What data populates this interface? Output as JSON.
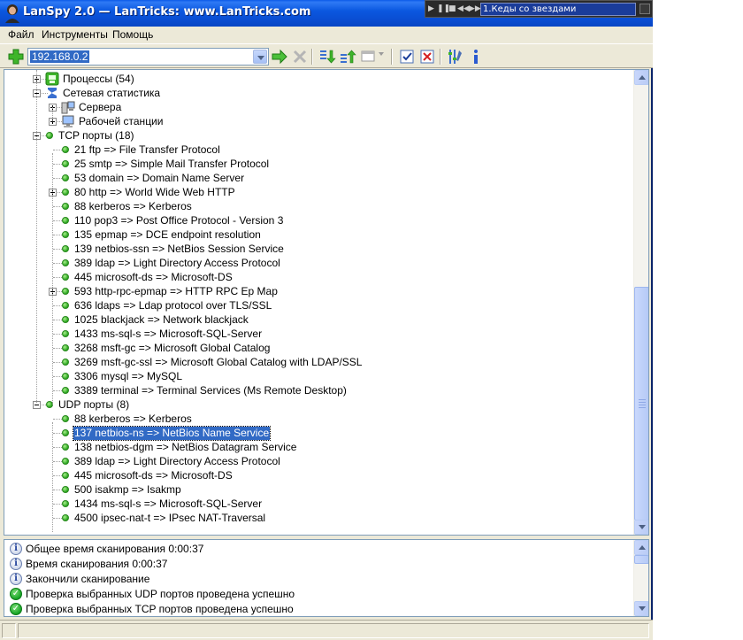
{
  "window": {
    "title": "LanSpy 2.0 — LanTricks: www.LanTricks.com"
  },
  "player": {
    "controls": [
      "play-icon",
      "pause-icon",
      "stop-icon",
      "prev-icon",
      "next-icon"
    ],
    "track": "1.Кеды со звездами"
  },
  "menu": {
    "items": [
      "Файл",
      "Инструменты",
      "Помощь"
    ]
  },
  "toolbar": {
    "address_value": "192.168.0.2",
    "buttons": [
      "add-icon",
      "go-arrow-icon",
      "stop-x-icon",
      "import-icon",
      "export-icon",
      "view-icon",
      "check-icon",
      "uncheck-icon",
      "settings-icon",
      "info-icon"
    ]
  },
  "tree": {
    "processes": "Процессы (54)",
    "netstat": "Сетевая статистика",
    "servers": "Сервера",
    "workstations": "Рабочей станции",
    "tcp_header": "TCP порты (18)",
    "tcp": [
      "21 ftp => File Transfer Protocol",
      "25 smtp => Simple Mail Transfer Protocol",
      "53 domain => Domain Name Server",
      "80 http => World Wide Web HTTP",
      "88 kerberos => Kerberos",
      "110 pop3 => Post Office Protocol - Version 3",
      "135 epmap => DCE endpoint resolution",
      "139 netbios-ssn => NetBios Session Service",
      "389 ldap => Light Directory Access Protocol",
      "445 microsoft-ds => Microsoft-DS",
      "593 http-rpc-epmap => HTTP RPC Ep Map",
      "636 ldaps => Ldap protocol over TLS/SSL",
      "1025 blackjack => Network blackjack",
      "1433 ms-sql-s => Microsoft-SQL-Server",
      "3268 msft-gc => Microsoft Global Catalog",
      "3269 msft-gc-ssl => Microsoft Global Catalog with LDAP/SSL",
      "3306 mysql => MySQL",
      "3389 terminal => Terminal Services (Ms Remote Desktop)"
    ],
    "udp_header": "UDP порты (8)",
    "udp": [
      "88 kerberos => Kerberos",
      "137 netbios-ns => NetBios Name Service",
      "138 netbios-dgm => NetBios Datagram Service",
      "389 ldap => Light Directory Access Protocol",
      "445 microsoft-ds => Microsoft-DS",
      "500 isakmp => Isakmp",
      "1434 ms-sql-s => Microsoft-SQL-Server",
      "4500 ipsec-nat-t => IPsec NAT-Traversal"
    ],
    "selected": "137 netbios-ns => NetBios Name Service"
  },
  "log": [
    {
      "icon": "info-icon",
      "text": "Общее время сканирования 0:00:37"
    },
    {
      "icon": "info-icon",
      "text": "Время сканирования 0:00:37"
    },
    {
      "icon": "info-icon",
      "text": "Закончили сканирование"
    },
    {
      "icon": "check-green-icon",
      "text": "Проверка выбранных UDP портов проведена успешно"
    },
    {
      "icon": "check-green-icon",
      "text": "Проверка выбранных TCP портов проведена успешно"
    }
  ],
  "colors": {
    "titlebar": "#0a58e0",
    "selection": "#316ac5",
    "port_dot": "#2aa51f",
    "chrome": "#ece9d8"
  }
}
